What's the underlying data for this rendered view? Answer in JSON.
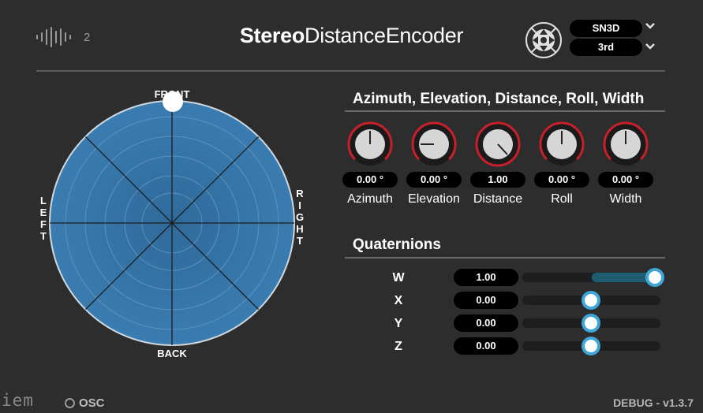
{
  "header": {
    "io_count": "2",
    "title_bold": "Stereo",
    "title_light": "DistanceEncoder",
    "normalization": "SN3D",
    "order": "3rd"
  },
  "sphere": {
    "front": "FRONT",
    "back": "BACK",
    "left": [
      "L",
      "E",
      "F",
      "T"
    ],
    "right": [
      "R",
      "I",
      "G",
      "H",
      "T"
    ]
  },
  "params": {
    "title": "Azimuth, Elevation, Distance, Roll, Width",
    "knobs": [
      {
        "label": "Azimuth",
        "value": "0.00 °"
      },
      {
        "label": "Elevation",
        "value": "0.00 °"
      },
      {
        "label": "Distance",
        "value": "1.00"
      },
      {
        "label": "Roll",
        "value": "0.00 °"
      },
      {
        "label": "Width",
        "value": "0.00 °"
      }
    ]
  },
  "quaternions": {
    "title": "Quaternions",
    "rows": [
      {
        "label": "W",
        "value": "1.00",
        "fraction": 1.0
      },
      {
        "label": "X",
        "value": "0.00",
        "fraction": 0.5
      },
      {
        "label": "Y",
        "value": "0.00",
        "fraction": 0.5
      },
      {
        "label": "Z",
        "value": "0.00",
        "fraction": 0.5
      }
    ]
  },
  "footer": {
    "logo": "iem",
    "osc": "OSC",
    "version": "DEBUG - v1.3.7"
  },
  "colors": {
    "background": "#2d2d2e",
    "knob_ring": "#c8202a",
    "slider_accent": "#3fa6d8",
    "sphere_blue": "#3c7fb5"
  }
}
